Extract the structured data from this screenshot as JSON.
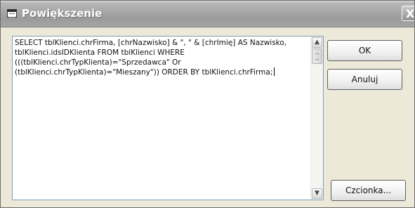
{
  "window": {
    "title": "Powiększenie",
    "close_glyph": "X"
  },
  "editor": {
    "sql_text": "SELECT tblKlienci.chrFirma, [chrNazwisko] & \", \" & [chrImię] AS Nazwisko, tblKlienci.idsIDKlienta FROM tblKlienci WHERE (((tblKlienci.chrTypKlienta)=\"Sprzedawca\" Or (tblKlienci.chrTypKlienta)=\"Mieszany\")) ORDER BY tblKlienci.chrFirma;",
    "scroll_up_glyph": "▲",
    "scroll_down_glyph": "▼"
  },
  "buttons": {
    "ok_label": "OK",
    "cancel_label": "Anuluj",
    "font_label": "Czcionka..."
  }
}
